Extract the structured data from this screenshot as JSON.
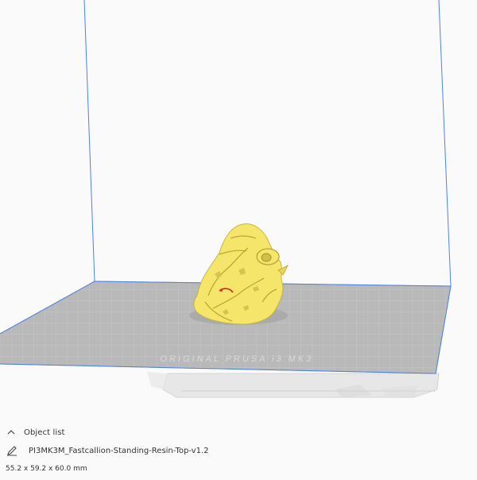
{
  "object_list": {
    "header_label": "Object list",
    "collapse_icon": "chevron-up-icon",
    "items": [
      {
        "name": "PI3MK3M_Fastcallion-Standing-Resin-Top-v1.2",
        "icon": "pencil-icon"
      }
    ],
    "dimensions": "55.2 x 59.2 x 60.0 mm"
  },
  "viewport": {
    "build_plate_label": "ORIGINAL PRUSA i3 MK3",
    "colors": {
      "model": "#f6e56b",
      "plate": "#b9b9b9",
      "frame": "#4a82e8",
      "background": "#fafafa"
    }
  }
}
